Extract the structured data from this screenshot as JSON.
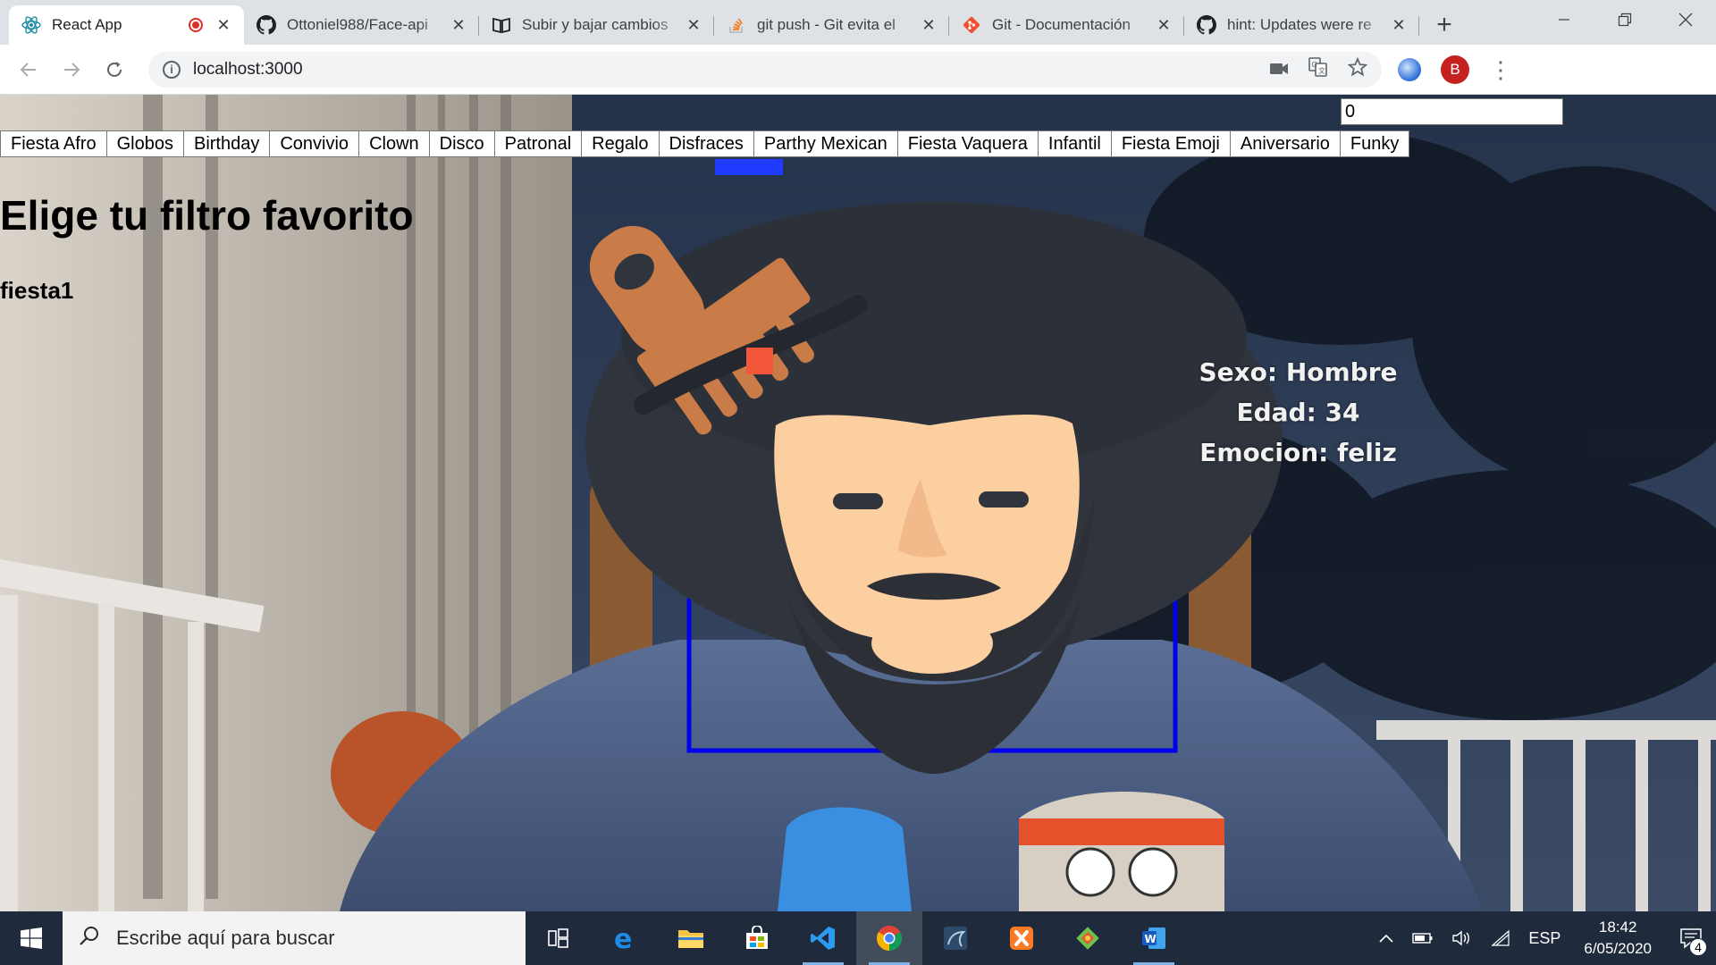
{
  "browser": {
    "tabs": [
      {
        "title": "React App",
        "icon": "react-icon",
        "active": true,
        "recording": true
      },
      {
        "title": "Ottoniel988/Face-api",
        "icon": "github-icon"
      },
      {
        "title": "Subir y bajar cambios",
        "icon": "book-icon"
      },
      {
        "title": "git push - Git evita el",
        "icon": "stackoverflow-icon"
      },
      {
        "title": "Git - Documentación",
        "icon": "git-icon"
      },
      {
        "title": "hint: Updates were re",
        "icon": "github-icon"
      }
    ],
    "new_tab_label": "+",
    "address": "localhost:3000",
    "profile_initial": "B"
  },
  "app": {
    "counter_value": "0",
    "filters": [
      "Fiesta Afro",
      "Globos",
      "Birthday",
      "Convivio",
      "Clown",
      "Disco",
      "Patronal",
      "Regalo",
      "Disfraces",
      "Parthy Mexican",
      "Fiesta Vaquera",
      "Infantil",
      "Fiesta Emoji",
      "Aniversario",
      "Funky"
    ],
    "heading": "Elige tu filtro favorito",
    "selected_filter": "fiesta1",
    "detection": {
      "sexo": "Sexo: Hombre",
      "edad": "Edad: 34",
      "emocion": "Emocion: feliz"
    }
  },
  "taskbar": {
    "search_placeholder": "Escribe aquí para buscar",
    "language": "ESP",
    "time": "18:42",
    "date": "6/05/2020",
    "notification_count": "4"
  },
  "colors": {
    "detection_box": "#0000ee",
    "afro_hair": "#30343d",
    "skin": "#fccfa0",
    "comb": "#c97b48"
  }
}
